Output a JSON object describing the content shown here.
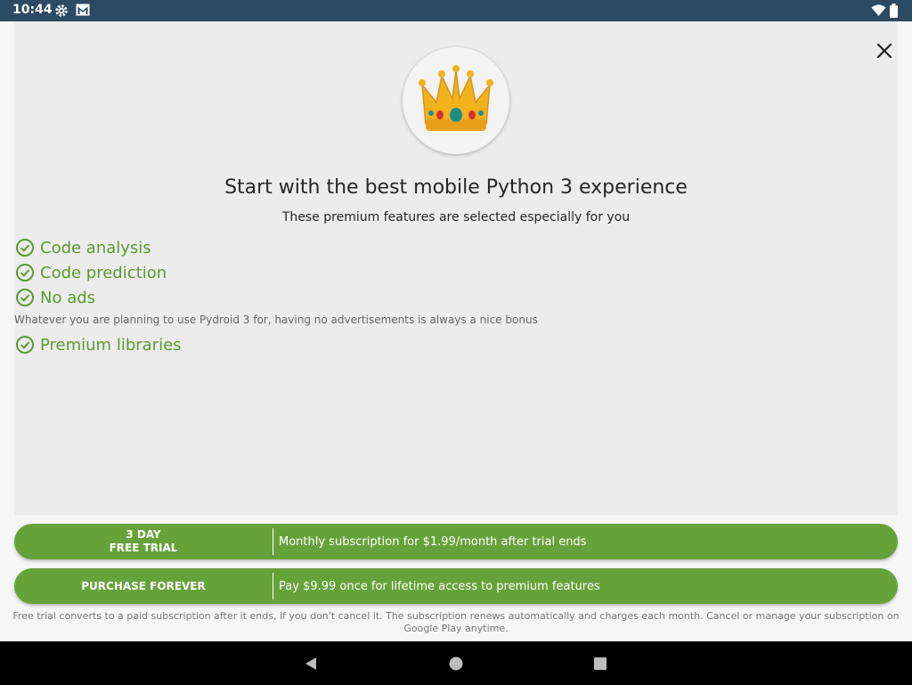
{
  "status_bar": {
    "time": "10:44",
    "icons": [
      "gear-icon",
      "gmail-icon",
      "wifi-icon",
      "battery-icon"
    ]
  },
  "header": {
    "badge_icon": "crown-icon",
    "title": "Start with the best mobile Python 3 experience",
    "subtitle": "These premium features are selected especially for you"
  },
  "features": [
    {
      "label": "Code analysis",
      "icon": "check-circle-icon"
    },
    {
      "label": "Code prediction",
      "icon": "check-circle-icon"
    },
    {
      "label": "No ads",
      "icon": "check-circle-icon",
      "description": "Whatever you are planning to use Pydroid 3 for, having no advertisements is always a nice bonus"
    },
    {
      "label": "Premium libraries",
      "icon": "check-circle-icon"
    }
  ],
  "offers": {
    "trial": {
      "line1": "3 DAY",
      "line2": "FREE TRIAL",
      "description": "Monthly subscription for $1.99/month after trial ends"
    },
    "purchase": {
      "label": "PURCHASE FOREVER",
      "description": "Pay $9.99 once for lifetime access to premium features"
    }
  },
  "disclaimer": "Free trial converts to a paid subscription after it ends, if you don't cancel it. The subscription renews automatically and charges each month. Cancel or manage your subscription on Google Play anytime.",
  "colors": {
    "accent": "#66a23a",
    "feature_text": "#5a9a2e",
    "status_bar": "#2d4a63"
  }
}
